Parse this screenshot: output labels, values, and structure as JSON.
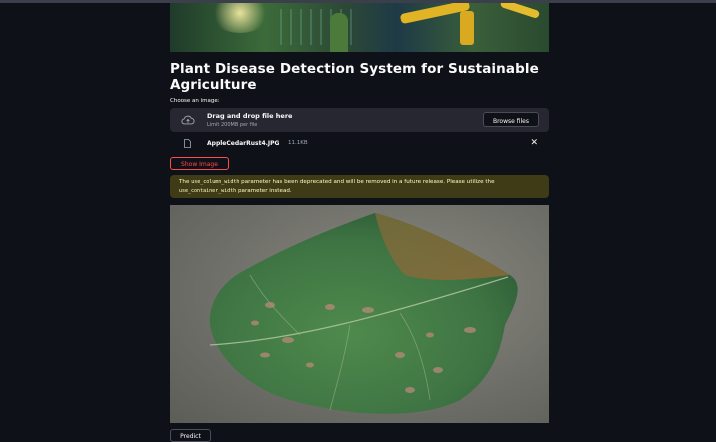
{
  "page": {
    "title": "Plant Disease Detection System for Sustainable Agriculture"
  },
  "uploader": {
    "label": "Choose an image:",
    "drop_text": "Drag and drop file here",
    "limit_text": "Limit 200MB per file",
    "browse_label": "Browse files",
    "icon": "cloud-upload-icon"
  },
  "file": {
    "name": "AppleCedarRust4.JPG",
    "size": "11.1KB",
    "icon": "file-icon",
    "close_icon": "close-icon",
    "close_glyph": "✕"
  },
  "actions": {
    "show_image_label": "Show Image",
    "predict_label": "Predict"
  },
  "warning": {
    "part1": "The ",
    "code1": "use_column_width",
    "part2": " parameter has been deprecated and will be removed in a future release. Please utilize the ",
    "code2": "use_container_width",
    "part3": " parameter instead."
  },
  "colors": {
    "background": "#0e1117",
    "accent": "#ff4b4b",
    "warning_bg": "#3e3b16",
    "warning_text": "#ffffc2"
  }
}
